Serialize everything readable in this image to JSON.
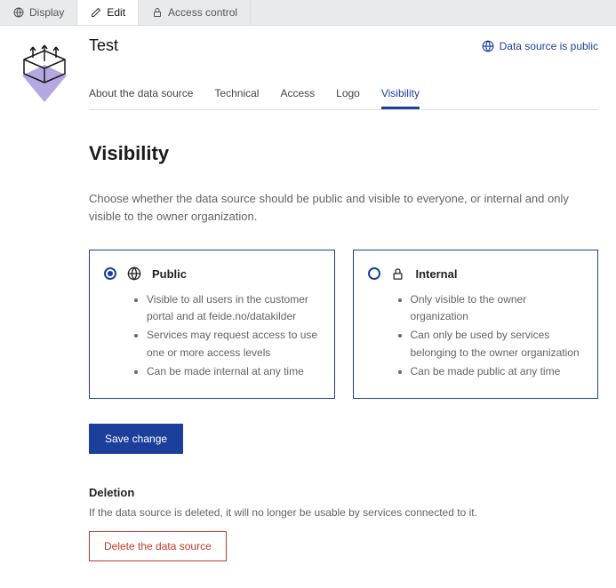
{
  "topTabs": {
    "display": "Display",
    "edit": "Edit",
    "access": "Access control"
  },
  "header": {
    "title": "Test",
    "publicBadge": "Data source is public"
  },
  "subTabs": {
    "about": "About the data source",
    "technical": "Technical",
    "access": "Access",
    "logo": "Logo",
    "visibility": "Visibility"
  },
  "visibility": {
    "heading": "Visibility",
    "intro": "Choose whether the data source should be public and visible to everyone, or internal and only visible to the owner organization.",
    "publicOption": {
      "label": "Public",
      "points": [
        "Visible to all users in the customer portal and at feide.no/datakilder",
        "Services may request access to use one or more access levels",
        "Can be made internal at any time"
      ]
    },
    "internalOption": {
      "label": "Internal",
      "points": [
        "Only visible to the owner organization",
        "Can only be used by services belonging to the owner organization",
        "Can be made public at any time"
      ]
    },
    "saveButton": "Save change"
  },
  "deletion": {
    "heading": "Deletion",
    "text": "If the data source is deleted, it will no longer be usable by services connected to it.",
    "button": "Delete the data source"
  }
}
